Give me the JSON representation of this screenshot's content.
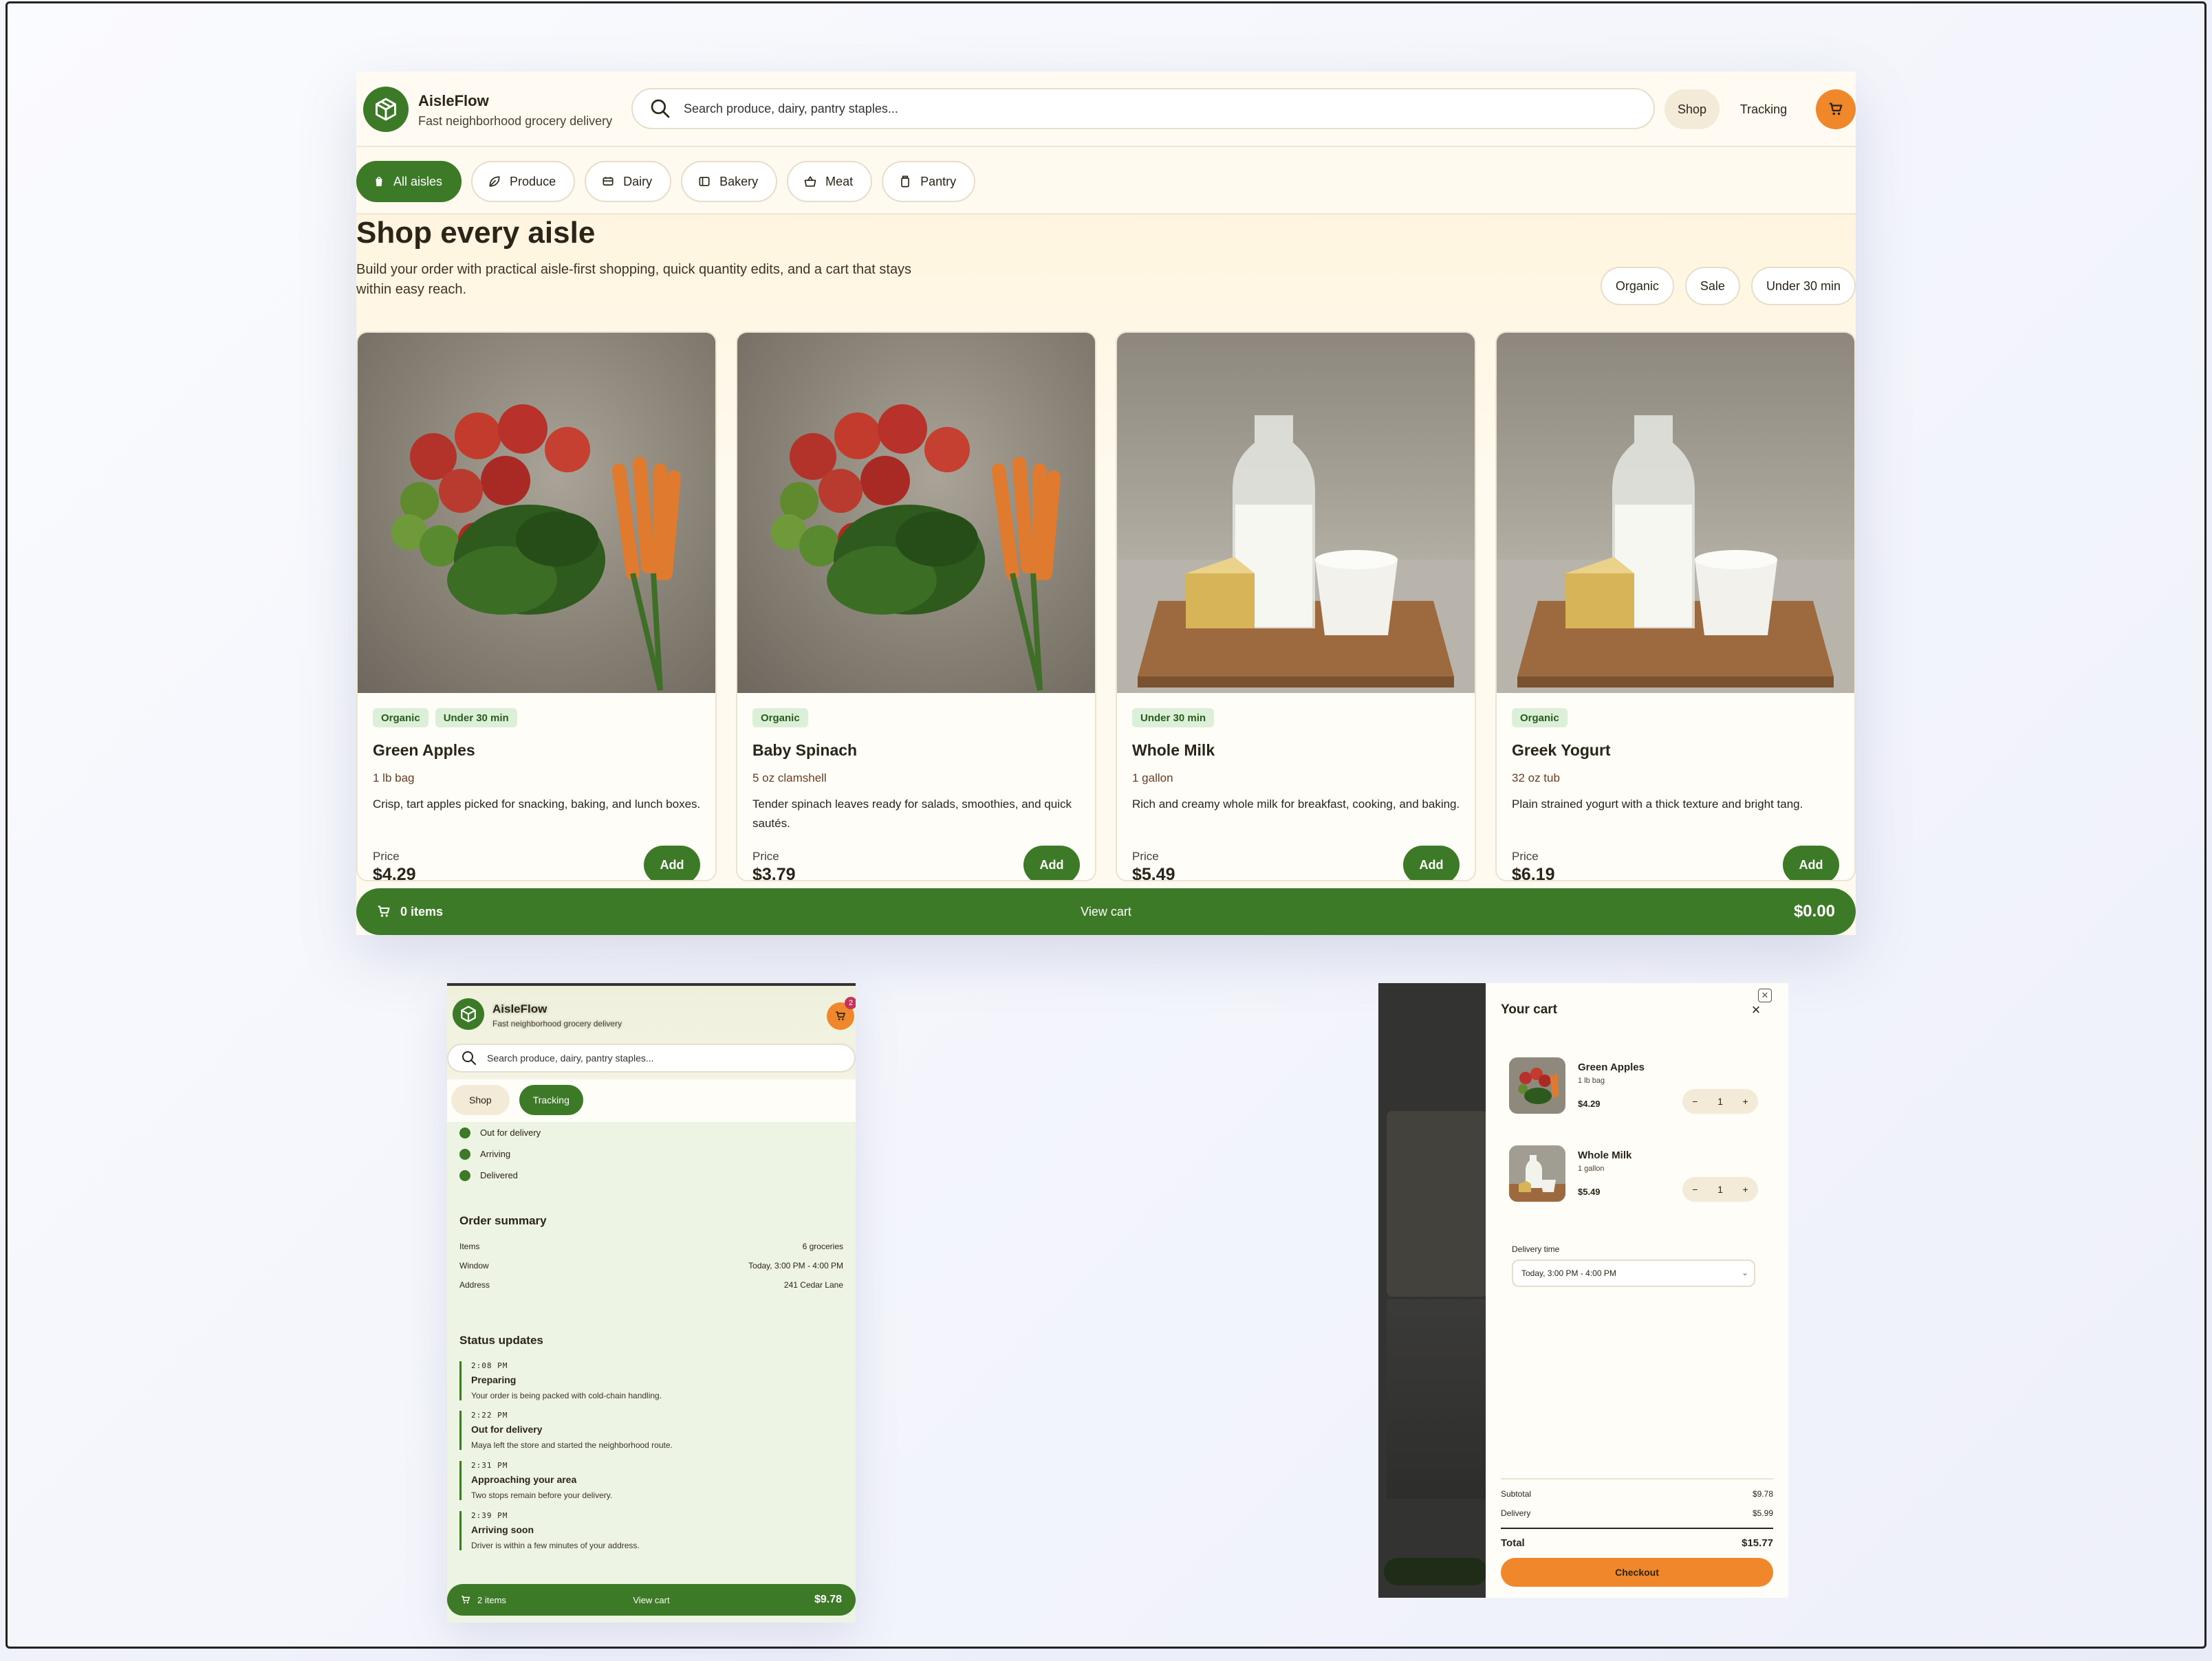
{
  "brand": {
    "name": "AisleFlow",
    "tagline": "Fast neighborhood grocery delivery"
  },
  "search": {
    "placeholder": "Search produce, dairy, pantry staples..."
  },
  "nav": {
    "shop": "Shop",
    "tracking": "Tracking"
  },
  "aisles": [
    "All aisles",
    "Produce",
    "Dairy",
    "Bakery",
    "Meat",
    "Pantry"
  ],
  "hero": {
    "title": "Shop every aisle",
    "subtitle": "Build your order with practical aisle-first shopping, quick quantity edits, and a cart that stays within easy reach."
  },
  "filters": [
    "Organic",
    "Sale",
    "Under 30 min"
  ],
  "products": [
    {
      "name": "Green Apples",
      "size": "1 lb bag",
      "desc": "Crisp, tart apples picked for snacking, baking, and lunch boxes.",
      "price_label": "Price",
      "price": "$4.29",
      "tags": [
        "Organic",
        "Under 30 min"
      ],
      "add": "Add",
      "image": "produce"
    },
    {
      "name": "Baby Spinach",
      "size": "5 oz clamshell",
      "desc": "Tender spinach leaves ready for salads, smoothies, and quick sautés.",
      "price_label": "Price",
      "price": "$3.79",
      "tags": [
        "Organic"
      ],
      "add": "Add",
      "image": "produce"
    },
    {
      "name": "Whole Milk",
      "size": "1 gallon",
      "desc": "Rich and creamy whole milk for breakfast, cooking, and baking.",
      "price_label": "Price",
      "price": "$5.49",
      "tags": [
        "Under 30 min"
      ],
      "add": "Add",
      "image": "dairy"
    },
    {
      "name": "Greek Yogurt",
      "size": "32 oz tub",
      "desc": "Plain strained yogurt with a thick texture and bright tang.",
      "price_label": "Price",
      "price": "$6.19",
      "tags": [
        "Organic"
      ],
      "add": "Add",
      "image": "dairy"
    }
  ],
  "desktop_cart_bar": {
    "items": "0 items",
    "view": "View cart",
    "total": "$0.00"
  },
  "mobile": {
    "badge": "2",
    "tabs": [
      "Shop",
      "Tracking"
    ],
    "steps": [
      "Out for delivery",
      "Arriving",
      "Delivered"
    ],
    "summary_title": "Order summary",
    "summary": [
      {
        "label": "Items",
        "value": "6 groceries"
      },
      {
        "label": "Window",
        "value": "Today, 3:00 PM - 4:00 PM"
      },
      {
        "label": "Address",
        "value": "241 Cedar Lane"
      }
    ],
    "updates_title": "Status updates",
    "updates": [
      {
        "time": "2:08 PM",
        "title": "Preparing",
        "desc": "Your order is being packed with cold-chain handling."
      },
      {
        "time": "2:22 PM",
        "title": "Out for delivery",
        "desc": "Maya left the store and started the neighborhood route."
      },
      {
        "time": "2:31 PM",
        "title": "Approaching your area",
        "desc": "Two stops remain before your delivery."
      },
      {
        "time": "2:39 PM",
        "title": "Arriving soon",
        "desc": "Driver is within a few minutes of your address."
      }
    ],
    "cart_bar": {
      "items": "2 items",
      "view": "View cart",
      "total": "$9.78"
    }
  },
  "cart": {
    "title": "Your cart",
    "items": [
      {
        "name": "Green Apples",
        "size": "1 lb bag",
        "price": "$4.29",
        "qty": "1",
        "image": "produce"
      },
      {
        "name": "Whole Milk",
        "size": "1 gallon",
        "price": "$5.49",
        "qty": "1",
        "image": "dairy"
      }
    ],
    "delivery_label": "Delivery time",
    "delivery_value": "Today, 3:00 PM - 4:00 PM",
    "subtotal_label": "Subtotal",
    "subtotal": "$9.78",
    "delivery_fee_label": "Delivery",
    "delivery_fee": "$5.99",
    "total_label": "Total",
    "total": "$15.77",
    "checkout": "Checkout"
  },
  "colors": {
    "green": "#3d7a27",
    "orange": "#f0872a",
    "cream": "#fffaf0",
    "badge": "#c8325a"
  }
}
